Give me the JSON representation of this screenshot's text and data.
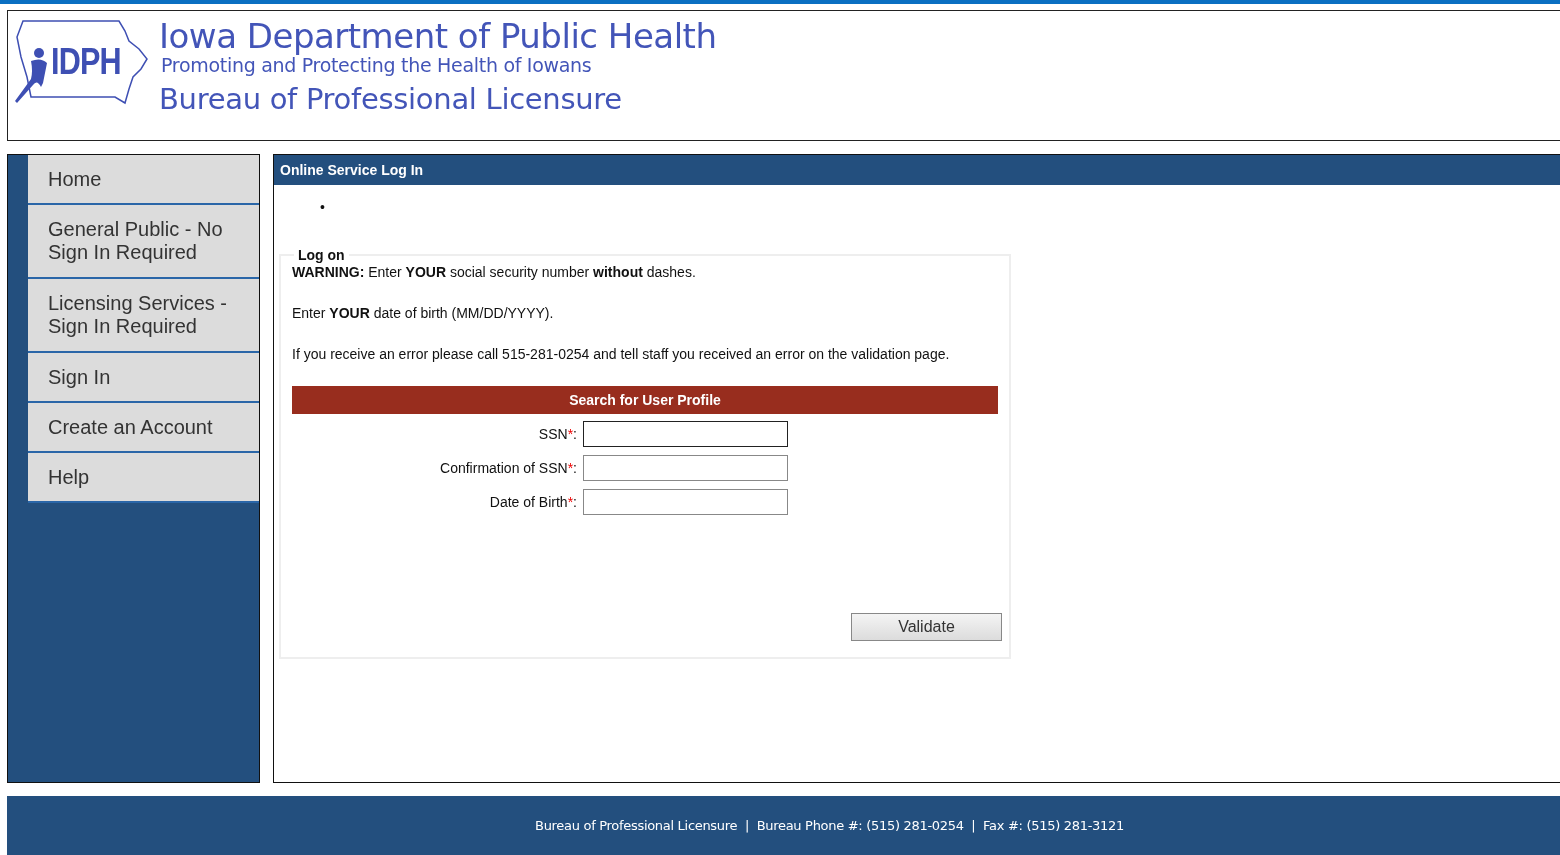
{
  "header": {
    "logo_text": "IDPH",
    "title": "Iowa Department of Public Health",
    "tagline": "Promoting and Protecting the Health of Iowans",
    "bureau": "Bureau of Professional Licensure"
  },
  "sidebar": {
    "items": [
      {
        "label": "Home"
      },
      {
        "label": "General Public - No Sign In Required"
      },
      {
        "label": "Licensing Services - Sign In Required"
      },
      {
        "label": "Sign In"
      },
      {
        "label": "Create an Account"
      },
      {
        "label": "Help"
      }
    ]
  },
  "panel": {
    "title": "Online Service Log In",
    "bullet": "•",
    "fieldset": {
      "legend": "Log on",
      "paragraphs": [
        "**WARNING:** Enter **YOUR** social security number **without** dashes.",
        "Enter **YOUR** date of birth (MM/DD/YYYY).",
        "If you receive an error please call 515-281-0254 and tell staff you received an error on the validation page."
      ],
      "section_title": "Search for User Profile",
      "fields": [
        {
          "label": "SSN",
          "required_mark": "*",
          "colon": ":",
          "focused": true
        },
        {
          "label": "Confirmation of SSN",
          "required_mark": "*",
          "colon": ":",
          "focused": false
        },
        {
          "label": "Date of Birth",
          "required_mark": "*",
          "colon": ":",
          "focused": false
        }
      ],
      "button": "Validate"
    }
  },
  "footer": {
    "text": "Bureau of Professional Licensure  |  Bureau Phone #: (515) 281-0254  |  Fax #: (515) 281-3121"
  }
}
